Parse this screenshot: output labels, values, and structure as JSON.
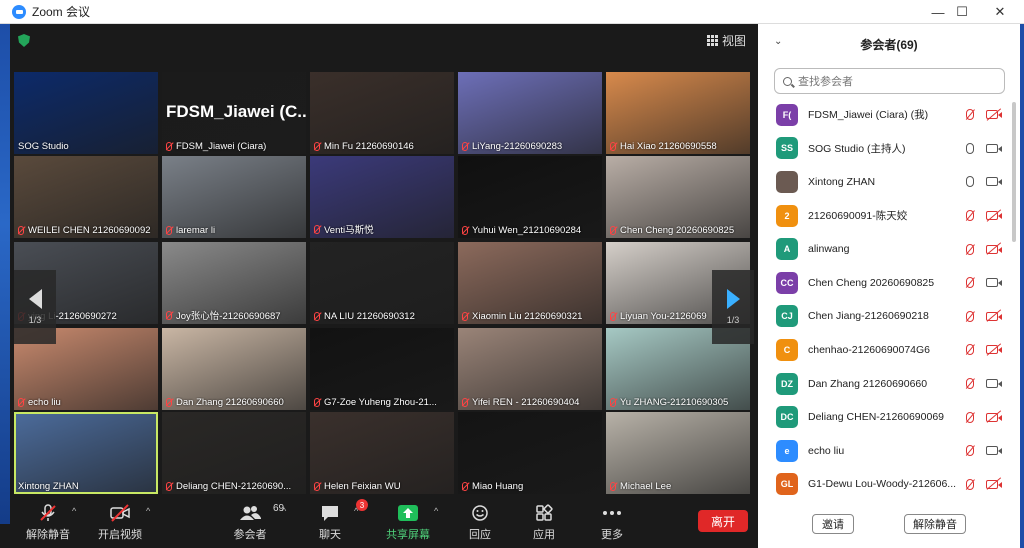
{
  "window": {
    "title": "Zoom 会议",
    "minimize": "—",
    "maximize": "☐",
    "close": "✕"
  },
  "view_label": "视图",
  "page_indicator": {
    "left": "1/3",
    "right": "1/3"
  },
  "tiles": [
    {
      "name": "SOG Studio",
      "muted": false,
      "bg": "#0c2a6a"
    },
    {
      "name": "FDSM_Jiawei (Ciara)",
      "muted": true,
      "bg": "#1b1b1b",
      "big": "FDSM_Jiawei   (C..."
    },
    {
      "name": "Min Fu 21260690146",
      "muted": true,
      "bg": "#3a2f2a"
    },
    {
      "name": "LiYang-21260690283",
      "muted": true,
      "bg": "#6d6fb8"
    },
    {
      "name": "Hai Xiao 21260690558",
      "muted": true,
      "bg": "#d88a4c"
    },
    {
      "name": "WEILEI CHEN 21260690092",
      "muted": true,
      "bg": "#5a4a3c"
    },
    {
      "name": "laremar li",
      "muted": true,
      "bg": "#7a8088"
    },
    {
      "name": "Venti马斯悦",
      "muted": true,
      "bg": "#3b3a7a"
    },
    {
      "name": "Yuhui Wen_21210690284",
      "muted": true,
      "bg": "#101010"
    },
    {
      "name": "Chen Cheng 20260690825",
      "muted": true,
      "bg": "#b9aea6"
    },
    {
      "name": "ying Li-21260690272",
      "muted": true,
      "bg": "#4a4e55"
    },
    {
      "name": "Joy张心怡-21260690687",
      "muted": true,
      "bg": "#8a8a8a"
    },
    {
      "name": "NA LIU 21260690312",
      "muted": true,
      "bg": "#232323"
    },
    {
      "name": "Xiaomin Liu 21260690321",
      "muted": true,
      "bg": "#8c6a5c"
    },
    {
      "name": "Liyuan You-2126069",
      "muted": true,
      "bg": "#d5cfc9"
    },
    {
      "name": "echo liu",
      "muted": true,
      "bg": "#c98a6e"
    },
    {
      "name": "Dan Zhang 21260690660",
      "muted": true,
      "bg": "#c9b6a4"
    },
    {
      "name": "G7-Zoe Yuheng Zhou-21...",
      "muted": true,
      "bg": "#121212"
    },
    {
      "name": "Yifei REN - 21260690404",
      "muted": true,
      "bg": "#9a8478"
    },
    {
      "name": "Yu ZHANG-21210690305",
      "muted": true,
      "bg": "#a6c9c4"
    },
    {
      "name": "Xintong ZHAN",
      "muted": false,
      "bg": "#4c6c9c",
      "active": true
    },
    {
      "name": "Deliang CHEN-21260690...",
      "muted": true,
      "bg": "#2a2826"
    },
    {
      "name": "Helen Feixian WU",
      "muted": true,
      "bg": "#3a302c"
    },
    {
      "name": "Miao Huang",
      "muted": true,
      "bg": "#141414"
    },
    {
      "name": "Michael Lee",
      "muted": true,
      "bg": "#b8b2a8"
    }
  ],
  "toolbar": {
    "unmute": "解除静音",
    "start_video": "开启视频",
    "participants": "参会者",
    "participants_count": "69",
    "chat": "聊天",
    "chat_badge": "3",
    "share": "共享屏幕",
    "reactions": "回应",
    "apps": "应用",
    "more": "更多",
    "leave": "离开"
  },
  "panel": {
    "title": "参会者(69)",
    "search_placeholder": "查找参会者",
    "invite": "邀请",
    "unmute_all": "解除静音"
  },
  "participants": [
    {
      "initials": "F(",
      "color": "#7b3fa8",
      "name": "FDSM_Jiawei (Ciara) (我)",
      "mic": "muted",
      "cam": "muted"
    },
    {
      "initials": "SS",
      "color": "#1f9a7a",
      "name": "SOG Studio (主持人)",
      "mic": "on",
      "cam": "on"
    },
    {
      "initials": "",
      "color": "#6b5a52",
      "name": "Xintong ZHAN",
      "mic": "on",
      "cam": "on"
    },
    {
      "initials": "2",
      "color": "#f0900f",
      "name": "21260690091-陈天姣",
      "mic": "muted",
      "cam": "muted"
    },
    {
      "initials": "A",
      "color": "#1f9a7a",
      "name": "alinwang",
      "mic": "muted",
      "cam": "muted"
    },
    {
      "initials": "CC",
      "color": "#7b3fa8",
      "name": "Chen Cheng 20260690825",
      "mic": "muted",
      "cam": "on"
    },
    {
      "initials": "CJ",
      "color": "#1f9a7a",
      "name": "Chen Jiang-21260690218",
      "mic": "muted",
      "cam": "muted"
    },
    {
      "initials": "C",
      "color": "#f0900f",
      "name": "chenhao-21260690074G6",
      "mic": "muted",
      "cam": "muted"
    },
    {
      "initials": "DZ",
      "color": "#1f9a7a",
      "name": "Dan Zhang 21260690660",
      "mic": "muted",
      "cam": "on"
    },
    {
      "initials": "DC",
      "color": "#1f9a7a",
      "name": "Deliang CHEN-21260690069",
      "mic": "muted",
      "cam": "muted"
    },
    {
      "initials": "e",
      "color": "#2d8cff",
      "name": "echo liu",
      "mic": "muted",
      "cam": "on"
    },
    {
      "initials": "GL",
      "color": "#e0641c",
      "name": "G1-Dewu Lou-Woody-212606...",
      "mic": "muted",
      "cam": "muted"
    }
  ]
}
